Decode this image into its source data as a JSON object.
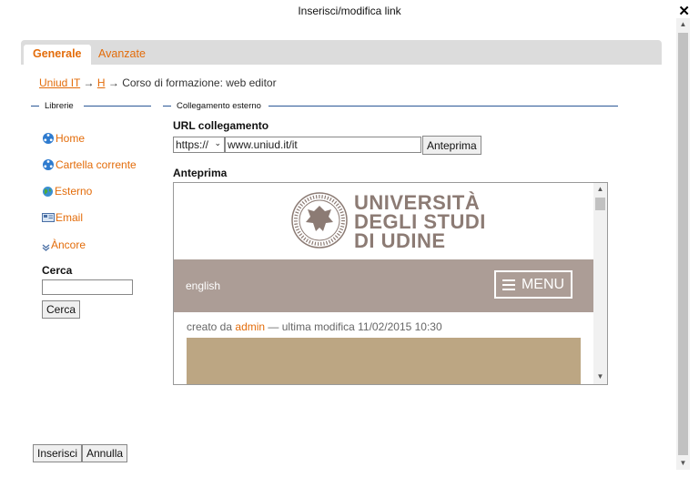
{
  "dialog": {
    "title": "Inserisci/modifica link",
    "close_symbol": "✕"
  },
  "tabs": [
    {
      "label": "Generale",
      "active": true
    },
    {
      "label": "Avanzate",
      "active": false
    }
  ],
  "breadcrumb": {
    "items": [
      "Uniud IT",
      "H"
    ],
    "current": "Corso di formazione: web editor",
    "separator": "→"
  },
  "librerie": {
    "title": "Librerie",
    "links": [
      {
        "label": "Home",
        "icon": "home-network-icon"
      },
      {
        "label": "Cartella corrente",
        "icon": "folder-network-icon"
      },
      {
        "label": "Esterno",
        "icon": "globe-icon"
      },
      {
        "label": "Email",
        "icon": "email-icon"
      },
      {
        "label": "Àncore",
        "icon": "anchor-icon"
      }
    ],
    "search_label": "Cerca",
    "search_value": "",
    "search_button": "Cerca"
  },
  "external": {
    "title": "Collegamento esterno",
    "url_label": "URL collegamento",
    "protocol": "https://",
    "url_value": "www.uniud.it/it",
    "preview_button": "Anteprima",
    "preview_label": "Anteprima"
  },
  "preview": {
    "university_lines": [
      "UNIVERSITÀ",
      "DEGLI STUDI",
      "DI UDINE"
    ],
    "seal_text": "UNIVERSITAS STUDIORUM UTINENSIS",
    "english": "english",
    "menu": "MENU",
    "meta_prefix": "creato da",
    "meta_author": "admin",
    "meta_suffix": "— ultima modifica 11/02/2015 10:30"
  },
  "footer": {
    "insert_button": "Inserisci",
    "cancel_button": "Annulla"
  },
  "colors": {
    "accent": "#e36c0a",
    "banner": "#ac9d96",
    "block": "#bca683",
    "logo_text": "#8c7b74"
  }
}
